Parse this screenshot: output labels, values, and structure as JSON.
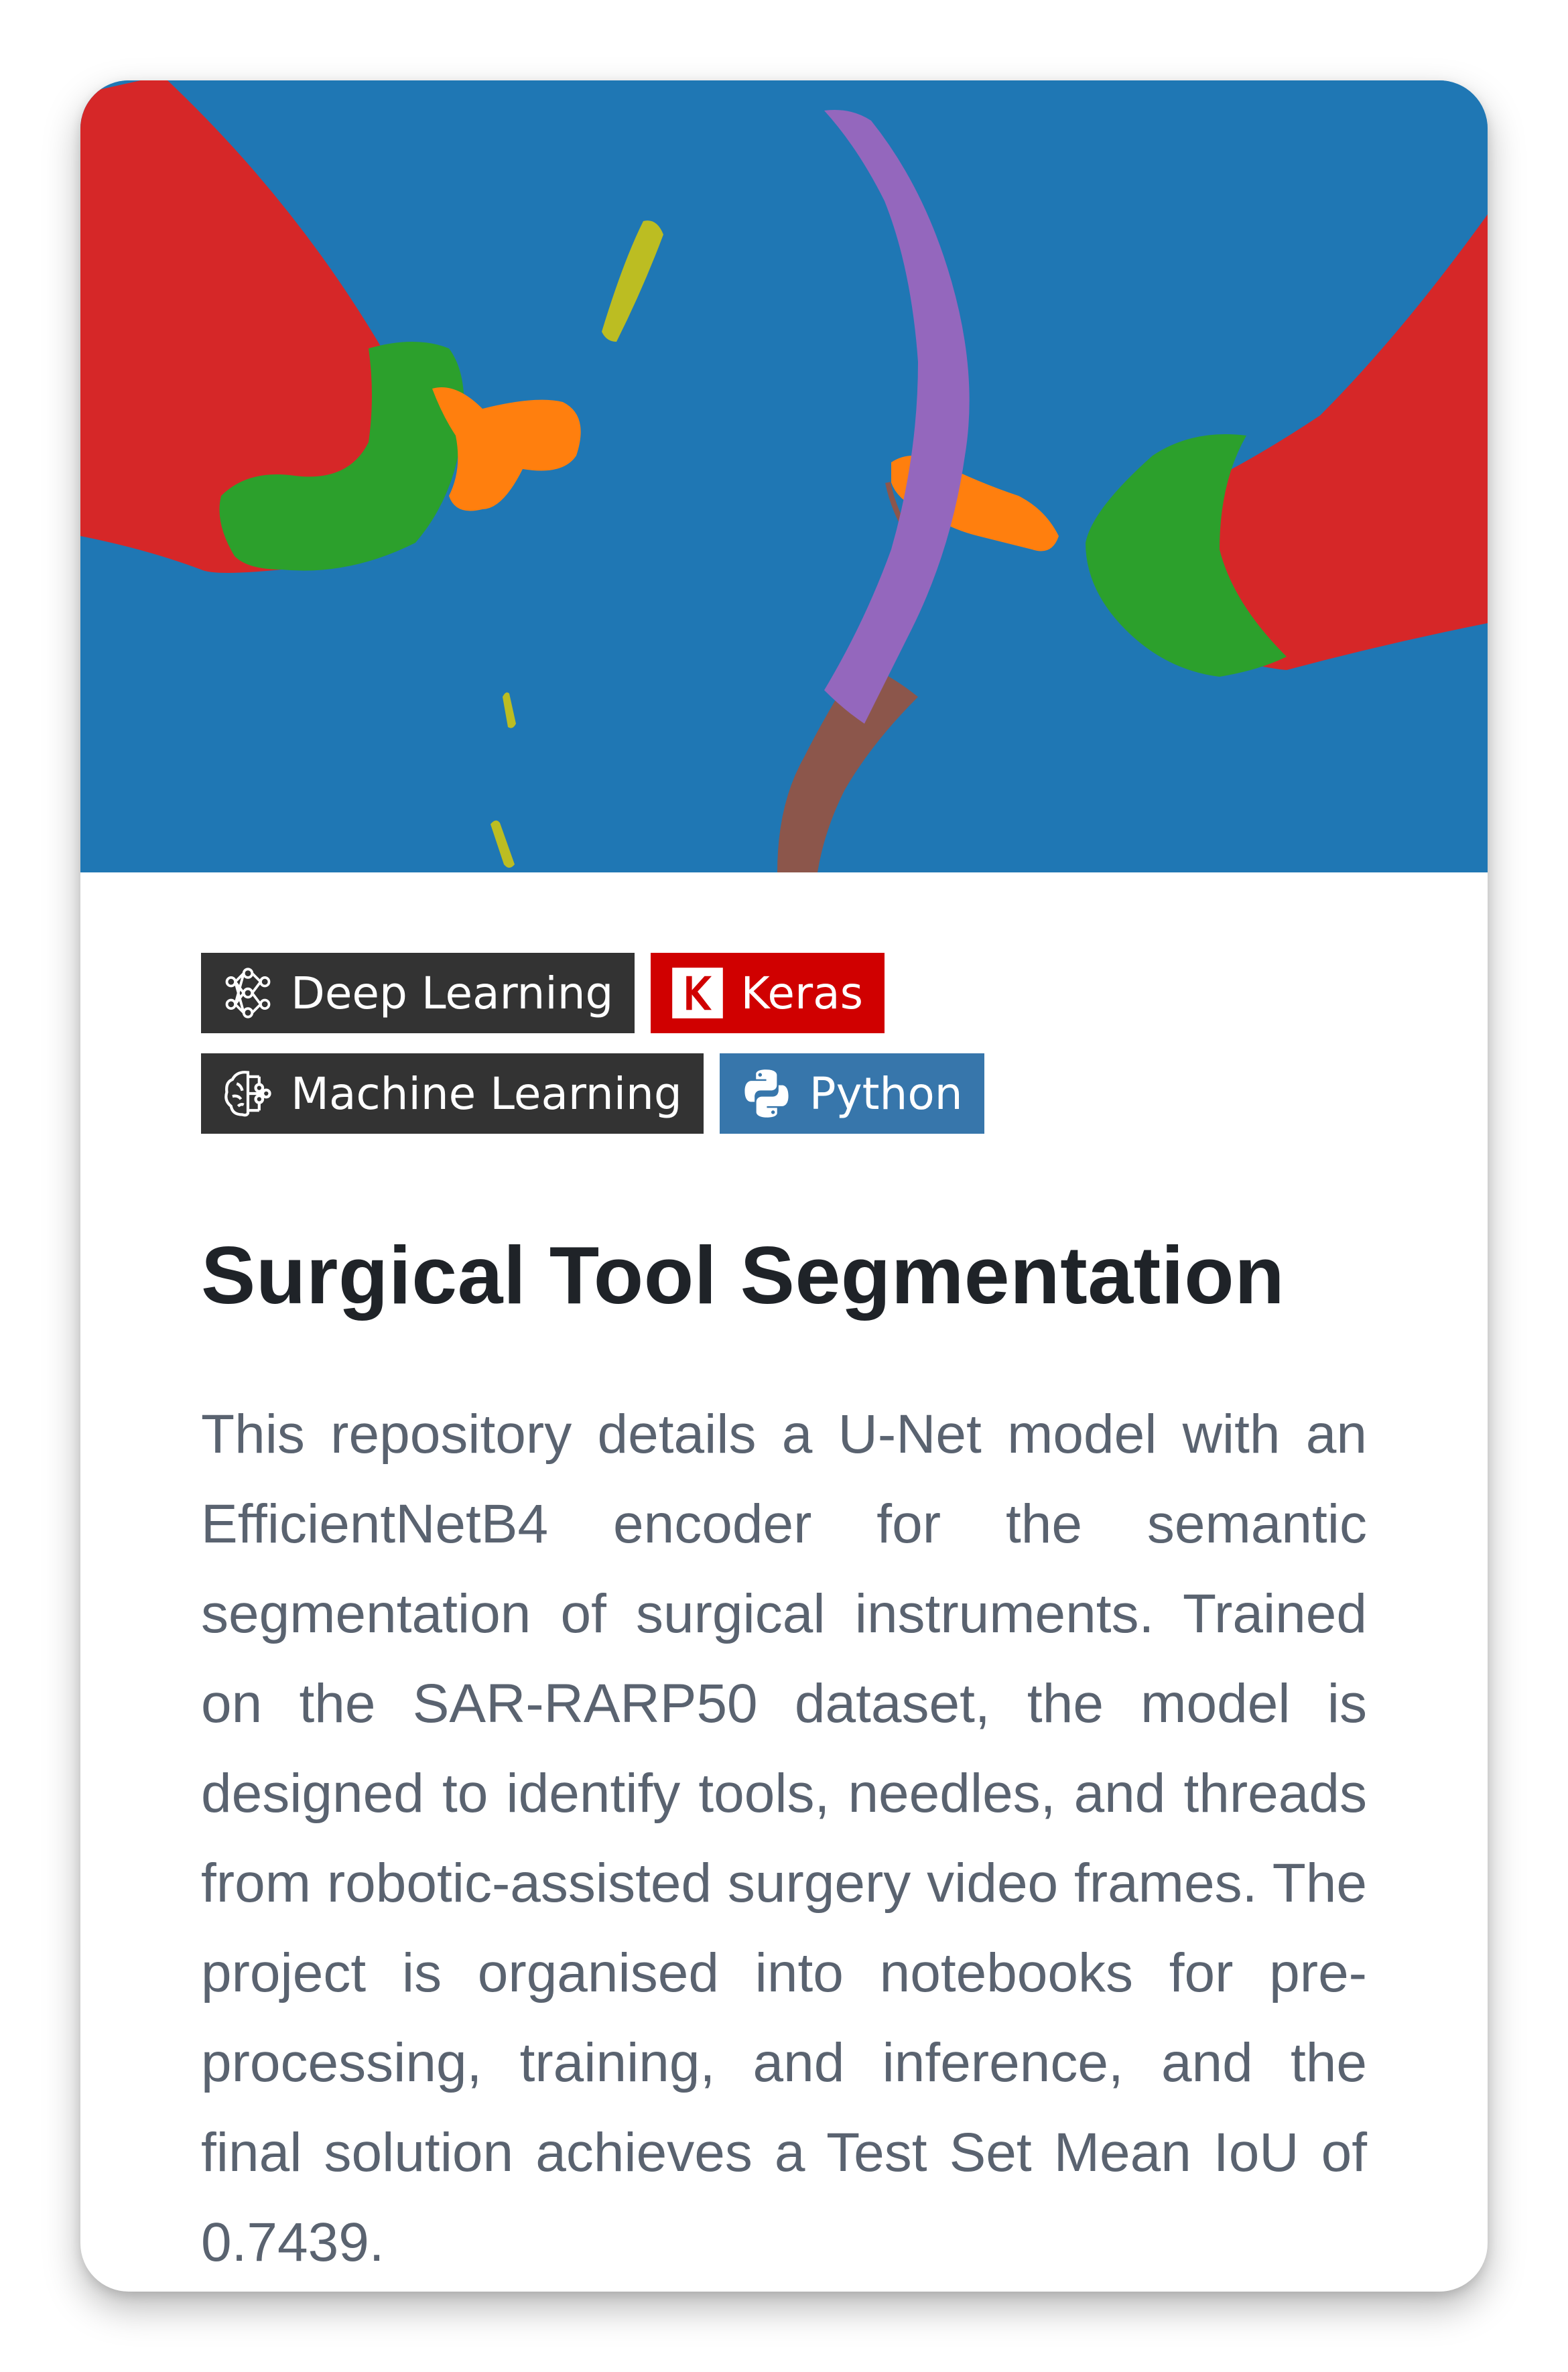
{
  "hero": {
    "icon_name": "segmentation-mask-image",
    "colors": {
      "background": "#1f77b4",
      "tool_shaft": "#d62728",
      "tool_wrist": "#2ca02c",
      "tool_clasper": "#ff7f0e",
      "needle": "#9467bd",
      "thread": "#8c564b",
      "suturing_fragment": "#bcbd22"
    }
  },
  "tags": [
    {
      "label": "Deep Learning",
      "icon": "neural-network-icon",
      "color": "#333333"
    },
    {
      "label": "Keras",
      "icon": "keras-icon",
      "color": "#d00000"
    },
    {
      "label": "Machine Learning",
      "icon": "brain-circuit-icon",
      "color": "#333333"
    },
    {
      "label": "Python",
      "icon": "python-icon",
      "color": "#3776ab"
    }
  ],
  "title": "Surgical Tool Segmentation",
  "description": "This repository details a U-Net model with an EfficientNetB4 encoder for the semantic segmentation of surgical instruments. Trained on the SAR-RARP50 dataset, the model is designed to identify tools, needles, and threads from robotic-assisted surgery video frames. The project is organised into notebooks for pre-processing, training, and inference, and the final solution achieves a Test Set Mean IoU of 0.7439."
}
